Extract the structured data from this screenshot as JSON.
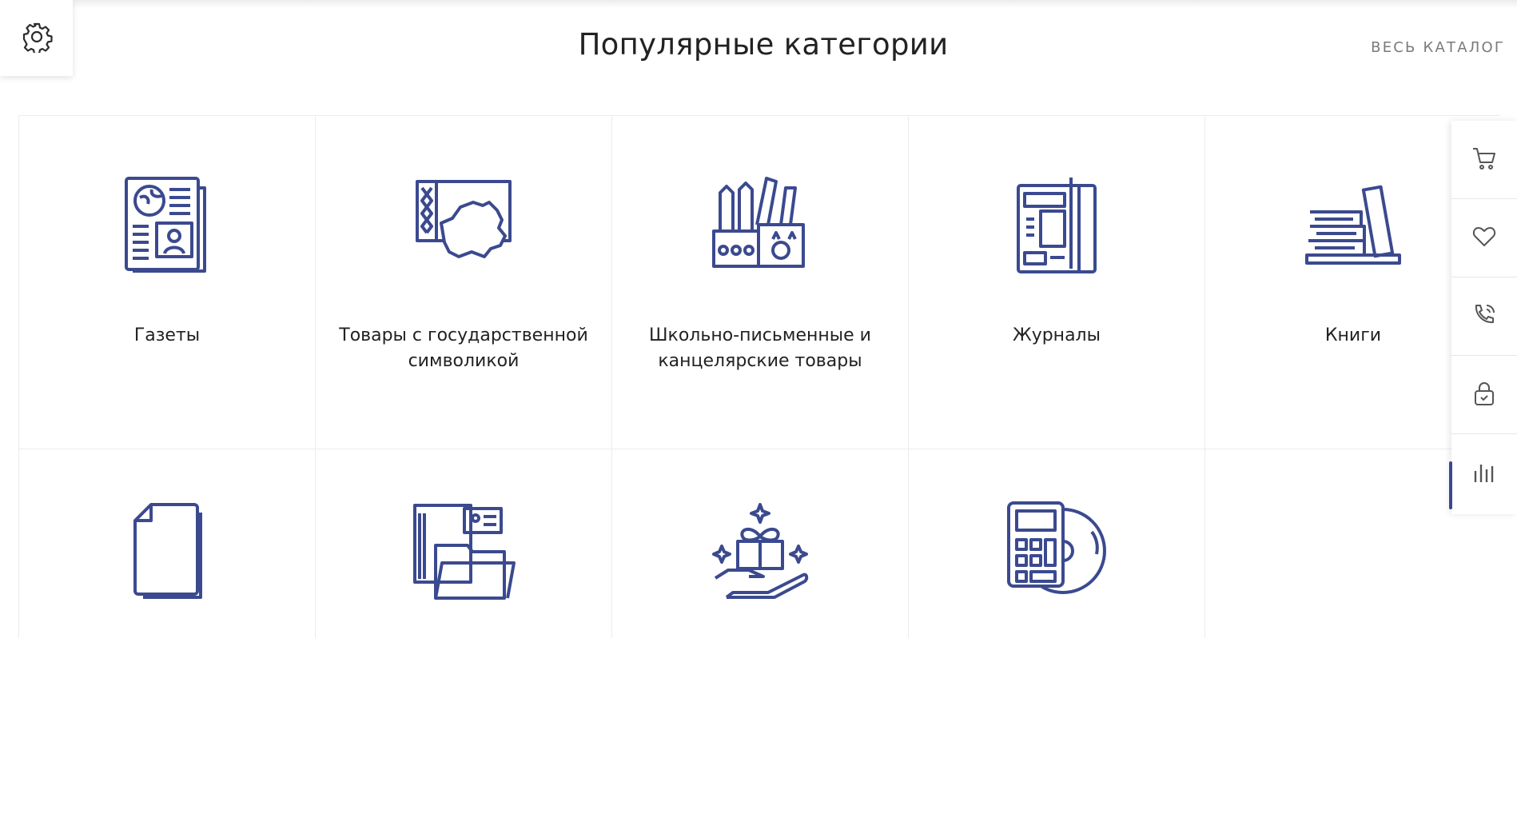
{
  "header": {
    "title": "Популярные категории",
    "all_catalog_link": "ВЕСЬ КАТАЛОГ"
  },
  "settings": {
    "icon": "gear-icon"
  },
  "categories": [
    {
      "label": "Газеты",
      "icon": "newspaper-icon"
    },
    {
      "label": "Товары с государственной символикой",
      "icon": "belarus-flag-map-icon"
    },
    {
      "label": "Школьно-письменные и канцелярские товары",
      "icon": "stationery-cup-icon"
    },
    {
      "label": "Журналы",
      "icon": "magazine-icon"
    },
    {
      "label": "Книги",
      "icon": "books-stack-icon"
    },
    {
      "label": "",
      "icon": "documents-icon"
    },
    {
      "label": "",
      "icon": "folders-icon"
    },
    {
      "label": "",
      "icon": "gift-hand-icon"
    },
    {
      "label": "",
      "icon": "calculator-disc-icon"
    }
  ],
  "side_panel": {
    "buttons": [
      {
        "icon": "cart-icon"
      },
      {
        "icon": "heart-icon"
      },
      {
        "icon": "callback-phone-icon"
      },
      {
        "icon": "lock-icon"
      },
      {
        "icon": "compare-bars-icon"
      }
    ]
  },
  "colors": {
    "icon_stroke": "#3b4a8f",
    "text": "#222222",
    "muted_link": "#7a7a7a",
    "border": "#ececec"
  }
}
